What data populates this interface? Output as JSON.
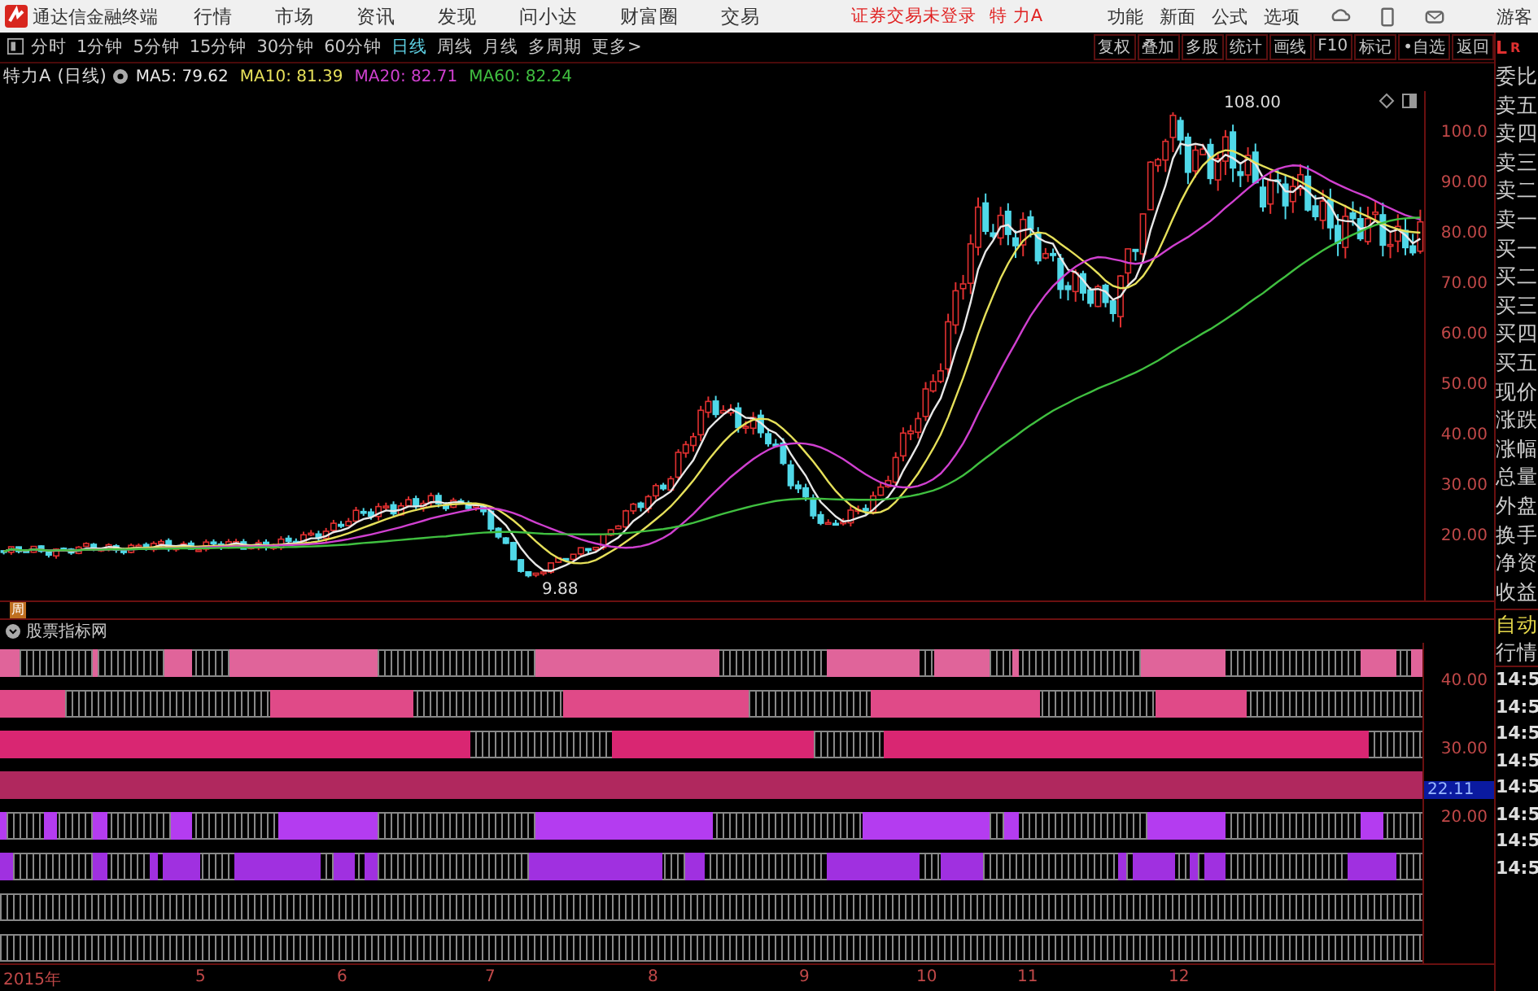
{
  "title_bar": {
    "app_title": "通达信金融终端",
    "menu": [
      "行情",
      "市场",
      "资讯",
      "发现",
      "问小达",
      "财富圈",
      "交易"
    ],
    "notice": "证券交易未登录",
    "stock": "特 力A",
    "right_menu": [
      "功能",
      "新面",
      "公式",
      "选项"
    ],
    "user": "游客"
  },
  "toolbar": {
    "periods": [
      {
        "label": "分时",
        "selected": false
      },
      {
        "label": "1分钟",
        "selected": false
      },
      {
        "label": "5分钟",
        "selected": false
      },
      {
        "label": "15分钟",
        "selected": false
      },
      {
        "label": "30分钟",
        "selected": false
      },
      {
        "label": "60分钟",
        "selected": false
      },
      {
        "label": "日线",
        "selected": true
      },
      {
        "label": "周线",
        "selected": false
      },
      {
        "label": "月线",
        "selected": false
      },
      {
        "label": "多周期",
        "selected": false
      },
      {
        "label": "更多>",
        "selected": false
      }
    ],
    "actions": [
      "复权",
      "叠加",
      "多股",
      "统计",
      "画线",
      "F10",
      "标记",
      "•自选",
      "返回"
    ]
  },
  "panel_header": {
    "left": "L",
    "right": "R"
  },
  "legend": {
    "stock": "特力A",
    "period": "(日线)",
    "mas": [
      {
        "label": "MA5: 79.62",
        "color": "#e8e8e8"
      },
      {
        "label": "MA10: 81.39",
        "color": "#e6e05a"
      },
      {
        "label": "MA20: 82.71",
        "color": "#d040d0"
      },
      {
        "label": "MA60: 82.24",
        "color": "#40c040"
      }
    ]
  },
  "chart": {
    "high_label": "108.00",
    "low_label": "9.88"
  },
  "price_axis": [
    "100.0",
    "90.00",
    "80.00",
    "70.00",
    "60.00",
    "50.00",
    "40.00",
    "30.00",
    "20.00"
  ],
  "quote_labels": [
    "委比",
    "卖五",
    "卖四",
    "卖三",
    "卖二",
    "卖一",
    "买一",
    "买二",
    "买三",
    "买四",
    "买五",
    "现价",
    "涨跌",
    "涨幅",
    "总量",
    "外盘",
    "换手",
    "净资",
    "收益"
  ],
  "indicator": {
    "marker": "周",
    "title": "股票指标网",
    "bands": [
      {
        "kind": "filled",
        "color": "#e0649a"
      },
      {
        "kind": "filled",
        "color": "#e04a88"
      },
      {
        "kind": "filled",
        "color": "#d92672"
      },
      {
        "kind": "filled",
        "color": "#b0285e"
      },
      {
        "kind": "filled",
        "color": "#b43cf0"
      },
      {
        "kind": "filled",
        "color": "#a030e0"
      },
      {
        "kind": "empty"
      },
      {
        "kind": "empty"
      }
    ],
    "axis": [
      {
        "label": "40.00",
        "kind": "tick"
      },
      {
        "label": "30.00",
        "kind": "tick"
      },
      {
        "label": "22.11",
        "kind": "current"
      },
      {
        "label": "20.00",
        "kind": "tick"
      }
    ]
  },
  "side_lower": [
    {
      "label": "自动",
      "kind": "mode"
    },
    {
      "label": "行情",
      "kind": "tab"
    },
    {
      "label": "14:5",
      "kind": "time"
    },
    {
      "label": "14:5",
      "kind": "time"
    },
    {
      "label": "14:5",
      "kind": "time"
    },
    {
      "label": "14:5",
      "kind": "time"
    },
    {
      "label": "14:5",
      "kind": "time"
    },
    {
      "label": "14:5",
      "kind": "time"
    },
    {
      "label": "14:5",
      "kind": "time"
    },
    {
      "label": "14:5",
      "kind": "time"
    }
  ],
  "dates": [
    "2015年",
    "5",
    "6",
    "7",
    "8",
    "9",
    "10",
    "11",
    "12"
  ]
}
